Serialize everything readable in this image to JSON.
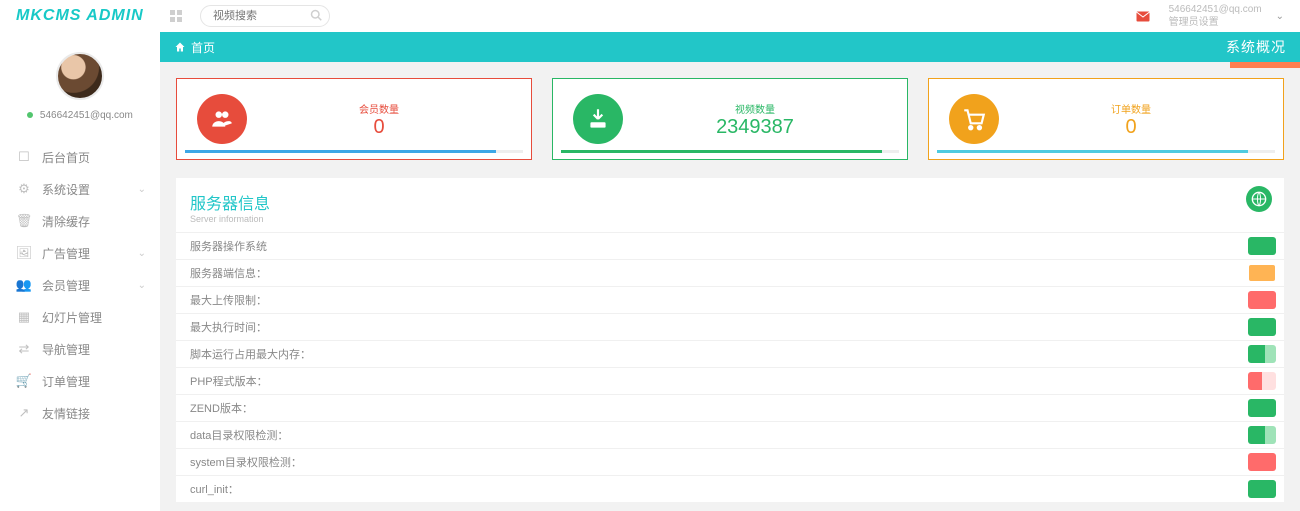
{
  "brand": "MKCMS ADMIN",
  "search": {
    "placeholder": "视频搜索"
  },
  "userTop": {
    "email": "546642451@qq.com",
    "settings": "管理员设置"
  },
  "profile": {
    "email": "546642451@qq.com"
  },
  "nav": [
    {
      "icon": "□",
      "label": "后台首页",
      "expand": false
    },
    {
      "icon": "⚙",
      "label": "系统设置",
      "expand": true
    },
    {
      "icon": "🗑",
      "label": "清除缓存",
      "expand": false
    },
    {
      "icon": "🖼",
      "label": "广告管理",
      "expand": true
    },
    {
      "icon": "👥",
      "label": "会员管理",
      "expand": true
    },
    {
      "icon": "▦",
      "label": "幻灯片管理",
      "expand": false
    },
    {
      "icon": "⇄",
      "label": "导航管理",
      "expand": false
    },
    {
      "icon": "🛒",
      "label": "订单管理",
      "expand": false
    },
    {
      "icon": "↗",
      "label": "友情链接",
      "expand": false
    }
  ],
  "breadcrumb": {
    "home": "首页",
    "overview": "系统概况"
  },
  "cards": {
    "members": {
      "label": "会员数量",
      "value": "0"
    },
    "videos": {
      "label": "视频数量",
      "value": "2349387"
    },
    "orders": {
      "label": "订单数量",
      "value": "0"
    }
  },
  "server": {
    "title": "服务器信息",
    "subtitle": "Server information",
    "rows": [
      "服务器操作系统",
      "服务器端信息：",
      "最大上传限制：",
      "最大执行时间：",
      "脚本运行占用最大内存：",
      "PHP程式版本：",
      "ZEND版本：",
      "data目录权限检测：",
      "system目录权限检测：",
      "curl_init："
    ]
  }
}
